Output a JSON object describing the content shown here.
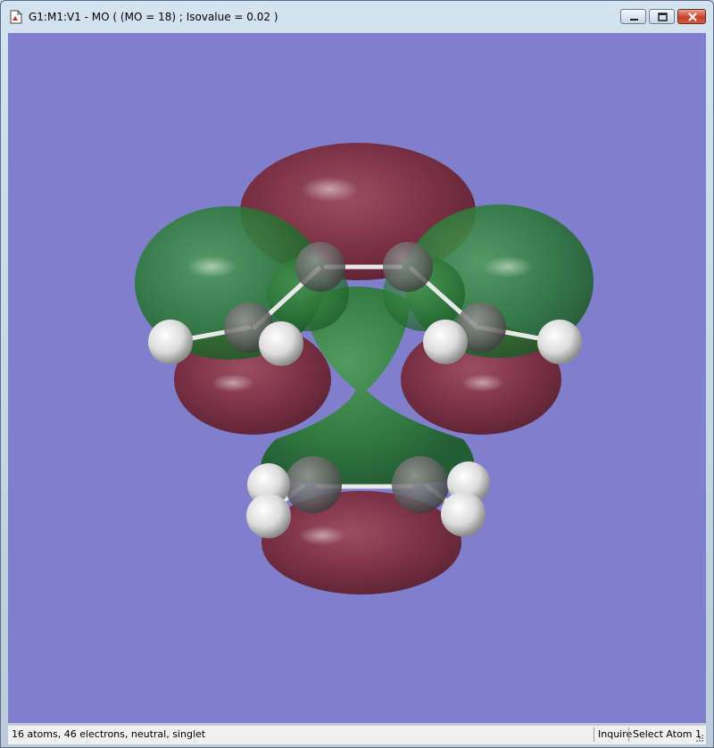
{
  "window": {
    "title": "G1:M1:V1 - MO ( (MO = 18) ; Isovalue = 0.02 )",
    "controls": {
      "minimize": "minimize",
      "maximize": "maximize",
      "close": "close"
    }
  },
  "viewport": {
    "background": "#7f7fcc",
    "lobe_positive_color": "#2e7a3a",
    "lobe_negative_color": "#7a2a3a",
    "atom_carbon_color": "#6a6a6a",
    "atom_hydrogen_color": "#f0f0f0"
  },
  "status": {
    "molecule_info": "16 atoms, 46 electrons, neutral, singlet",
    "mode": "Inquire",
    "selection": "Select Atom 1"
  }
}
